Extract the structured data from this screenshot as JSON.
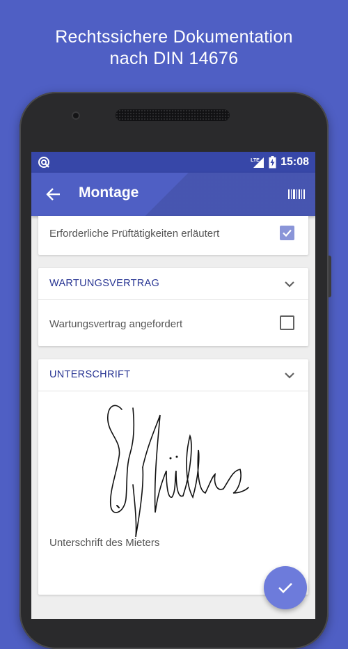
{
  "headline": {
    "line1": "Rechtssichere Dokumentation",
    "line2": "nach DIN 14676"
  },
  "statusbar": {
    "time": "15:08",
    "network": "LTE",
    "icons": [
      "notification-target-icon",
      "signal-icon",
      "battery-charging-icon"
    ]
  },
  "appbar": {
    "title": "Montage",
    "icons": [
      "back-arrow-icon",
      "barcode-icon"
    ]
  },
  "sections": [
    {
      "title": "",
      "items": [
        {
          "label": "Erforderliche Prüftätigkeiten erläutert",
          "checked": true
        }
      ]
    },
    {
      "title": "WARTUNGSVERTRAG",
      "items": [
        {
          "label": "Wartungsvertrag angefordert",
          "checked": false
        }
      ]
    },
    {
      "title": "UNTERSCHRIFT",
      "signature_caption": "Unterschrift des Mieters"
    }
  ],
  "colors": {
    "background": "#4f5fc4",
    "statusbar": "#3747a8",
    "appbar": "#4f5fc4",
    "section_title": "#283593",
    "checkbox_checked": "#8a95d8",
    "fab": "#6d7bdb"
  },
  "fab": {
    "icon": "checkmark-icon"
  }
}
